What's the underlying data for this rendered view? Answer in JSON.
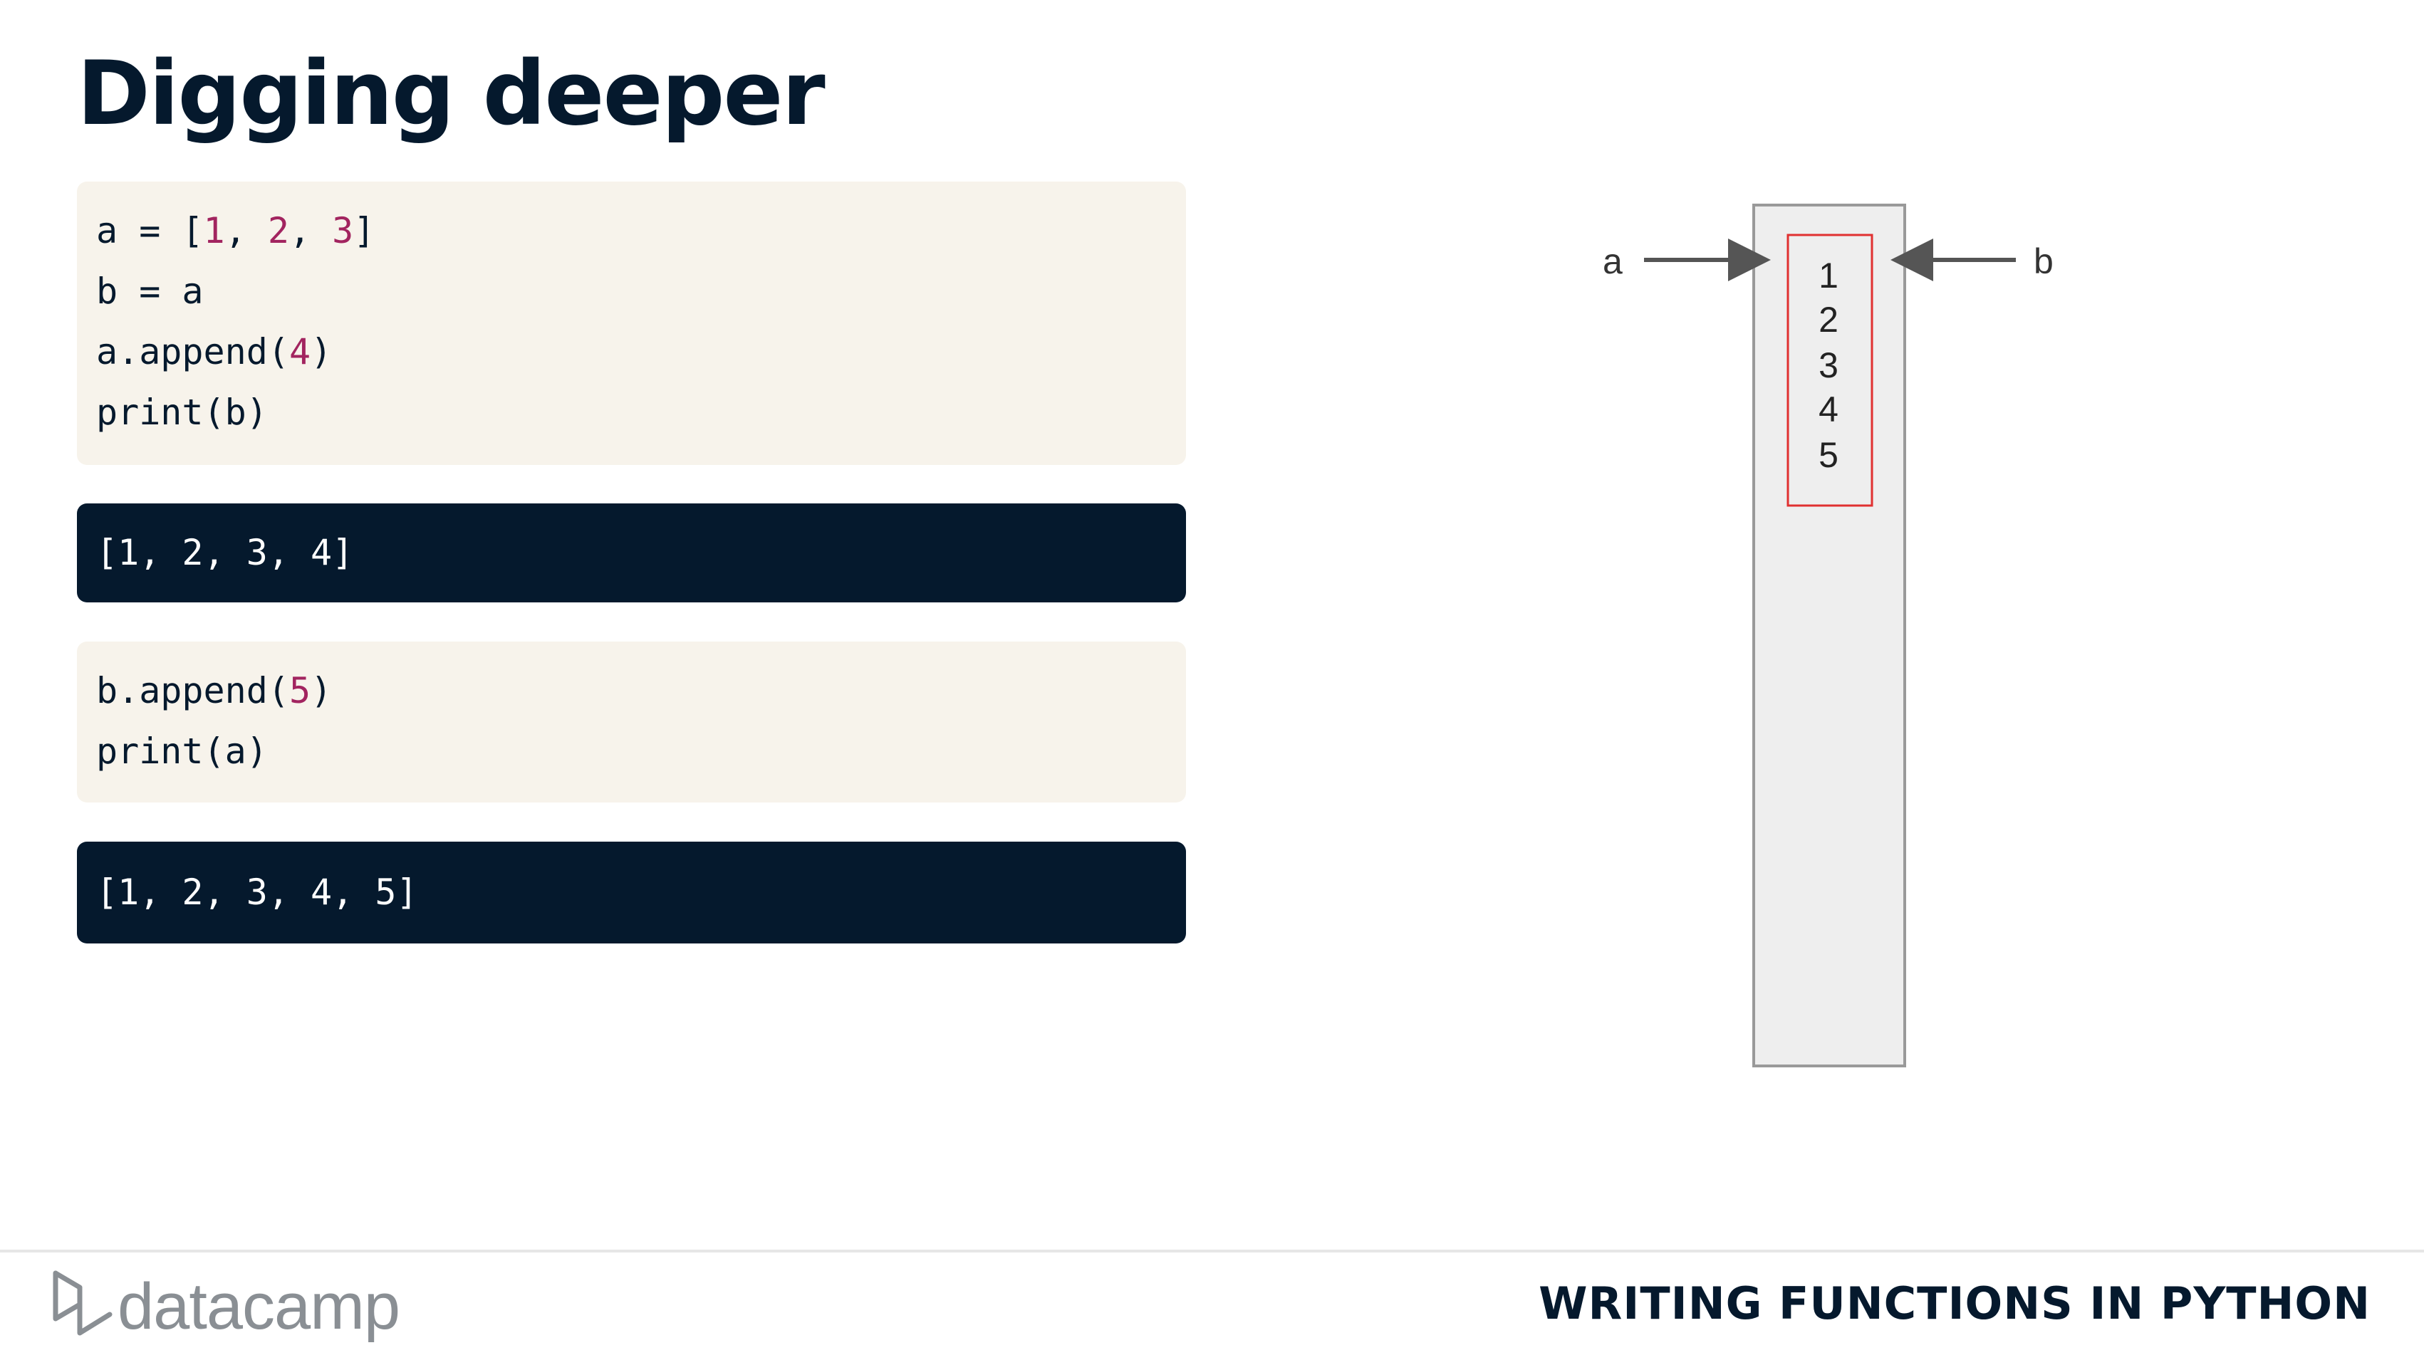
{
  "slide": {
    "title": "Digging deeper"
  },
  "code_block_1": {
    "lines": [
      {
        "parts": [
          "a = [",
          "1",
          ", ",
          "2",
          ", ",
          "3",
          "]"
        ]
      },
      {
        "text": "b = a"
      },
      {
        "parts": [
          "a.append(",
          "4",
          ")"
        ]
      },
      {
        "text": "print(b)"
      }
    ]
  },
  "output_1": "[1, 2, 3, 4]",
  "code_block_2": {
    "lines": [
      {
        "parts": [
          "b.append(",
          "5",
          ")"
        ]
      },
      {
        "text": "print(a)"
      }
    ]
  },
  "output_2": "[1, 2, 3, 4, 5]",
  "diagram": {
    "left_label": "a",
    "right_label": "b",
    "values": [
      "1",
      "2",
      "3",
      "4",
      "5"
    ],
    "colors": {
      "box_fill": "#eeeeee",
      "box_stroke": "#999999",
      "highlight_stroke": "#e03030",
      "arrow": "#555555"
    }
  },
  "footer": {
    "brand": "datacamp",
    "course": "WRITING FUNCTIONS IN PYTHON"
  },
  "colors": {
    "navy": "#05192d",
    "code_bg": "#f7f3eb",
    "number": "#a2245f"
  }
}
